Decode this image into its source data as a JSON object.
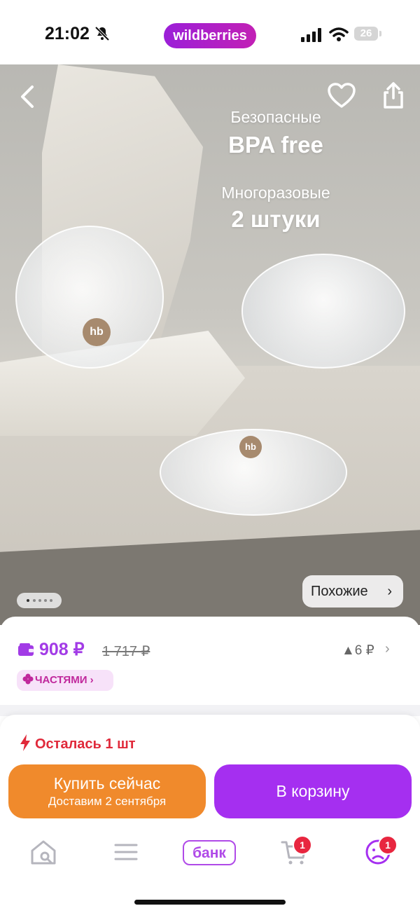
{
  "status_bar": {
    "time": "21:02",
    "battery": "26",
    "brand": "wildberries"
  },
  "hero": {
    "lines": [
      "Безопасные",
      "BPA free",
      "Многоразовые",
      "2 штуки"
    ],
    "badge_text": "hb",
    "similar_label": "Похожие",
    "similar_chevron": "›",
    "dots": 5
  },
  "price": {
    "current": "908 ₽",
    "old": "1 717 ₽",
    "delta": "▲6 ₽",
    "delta_chevron": "›",
    "installments": "ЧАСТЯМИ ›"
  },
  "stock": {
    "text": "Осталась 1 шт",
    "icon": "lightning-icon"
  },
  "actions": {
    "buy_now": "Купить сейчас",
    "delivery": "Доставим 2 сентября",
    "add_to_cart": "В корзину"
  },
  "tabbar": {
    "bank_label": "банк",
    "cart_badge": "1",
    "profile_badge": "1"
  },
  "colors": {
    "accent": "#a52ff0",
    "orange": "#f08a2c",
    "alert": "#e0293a"
  }
}
